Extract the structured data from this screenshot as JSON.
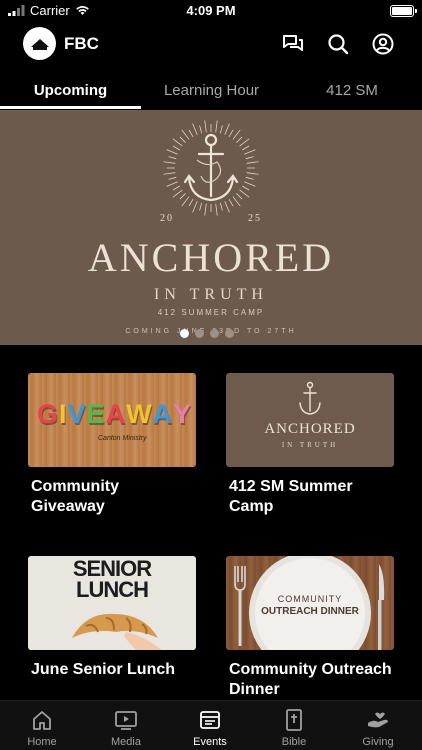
{
  "status_bar": {
    "carrier": "Carrier",
    "time": "4:09 PM"
  },
  "header": {
    "title": "FBC",
    "icons": [
      "messages-icon",
      "search-icon",
      "account-icon"
    ]
  },
  "tabs": [
    {
      "label": "Upcoming",
      "active": true
    },
    {
      "label": "Learning Hour",
      "active": false
    },
    {
      "label": "412 SM",
      "active": false
    }
  ],
  "hero": {
    "year_left": "20",
    "year_right": "25",
    "title": "ANCHORED",
    "subtitle": "IN TRUTH",
    "camp": "412 SUMMER CAMP",
    "date": "COMING JUNE 23RD TO 27TH",
    "carousel_count": 4,
    "carousel_active": 0
  },
  "cards": [
    {
      "title": "Community Giveaway",
      "image_text": "GIVEAWAY",
      "image_sub": "Canton Ministry"
    },
    {
      "title": "412 SM Summer Camp",
      "image_title": "ANCHORED",
      "image_sub": "IN TRUTH"
    },
    {
      "title": "June Senior Lunch",
      "image_line1": "SENIOR",
      "image_line2": "LUNCH"
    },
    {
      "title": "Community Outreach Dinner",
      "image_line1": "COMMUNITY",
      "image_line2": "OUTREACH DINNER"
    }
  ],
  "bottom_nav": [
    {
      "label": "Home",
      "icon": "home-icon",
      "active": false
    },
    {
      "label": "Media",
      "icon": "media-icon",
      "active": false
    },
    {
      "label": "Events",
      "icon": "events-icon",
      "active": true
    },
    {
      "label": "Bible",
      "icon": "bible-icon",
      "active": false
    },
    {
      "label": "Giving",
      "icon": "giving-icon",
      "active": false
    }
  ],
  "colors": {
    "background": "#000000",
    "hero_brown": "#6c5a4d",
    "text_muted": "#a8a8a8"
  }
}
